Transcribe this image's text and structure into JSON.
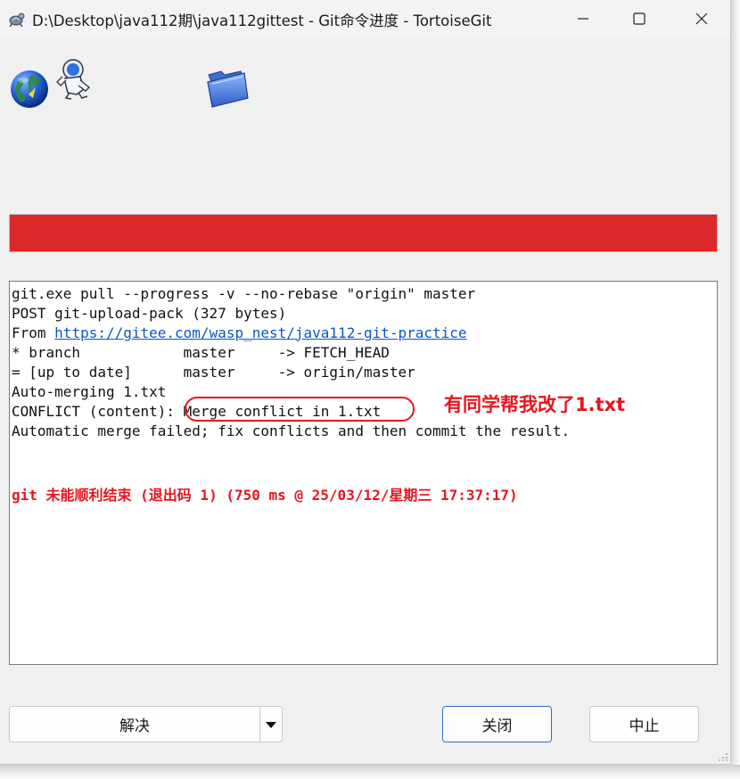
{
  "window": {
    "title": "D:\\Desktop\\java112期\\java112gittest - Git命令进度 - TortoiseGit"
  },
  "icons": [
    "tortoisegit-icon",
    "globe-icon",
    "astronaut-icon",
    "folder-icon"
  ],
  "progress": {
    "fraction": 1.0,
    "color": "#db2828"
  },
  "log": {
    "lines": [
      "git.exe pull --progress -v --no-rebase \"origin\" master",
      "POST git-upload-pack (327 bytes)",
      "From ",
      "* branch            master     -> FETCH_HEAD",
      "= [up to date]      master     -> origin/master",
      "Auto-merging 1.txt",
      "CONFLICT (content): Merge conflict in 1.txt",
      "Automatic merge failed; fix conflicts and then commit the result."
    ],
    "link": "https://gitee.com/wasp_nest/java112-git-practice",
    "error_line": "git 未能顺利结束 (退出码 1) (750 ms @ 25/03/12/星期三 17:37:17)"
  },
  "annotation": {
    "text": "有同学帮我改了1.txt",
    "color": "#e8141e"
  },
  "buttons": {
    "resolve": "解决",
    "close": "关闭",
    "abort": "中止"
  }
}
